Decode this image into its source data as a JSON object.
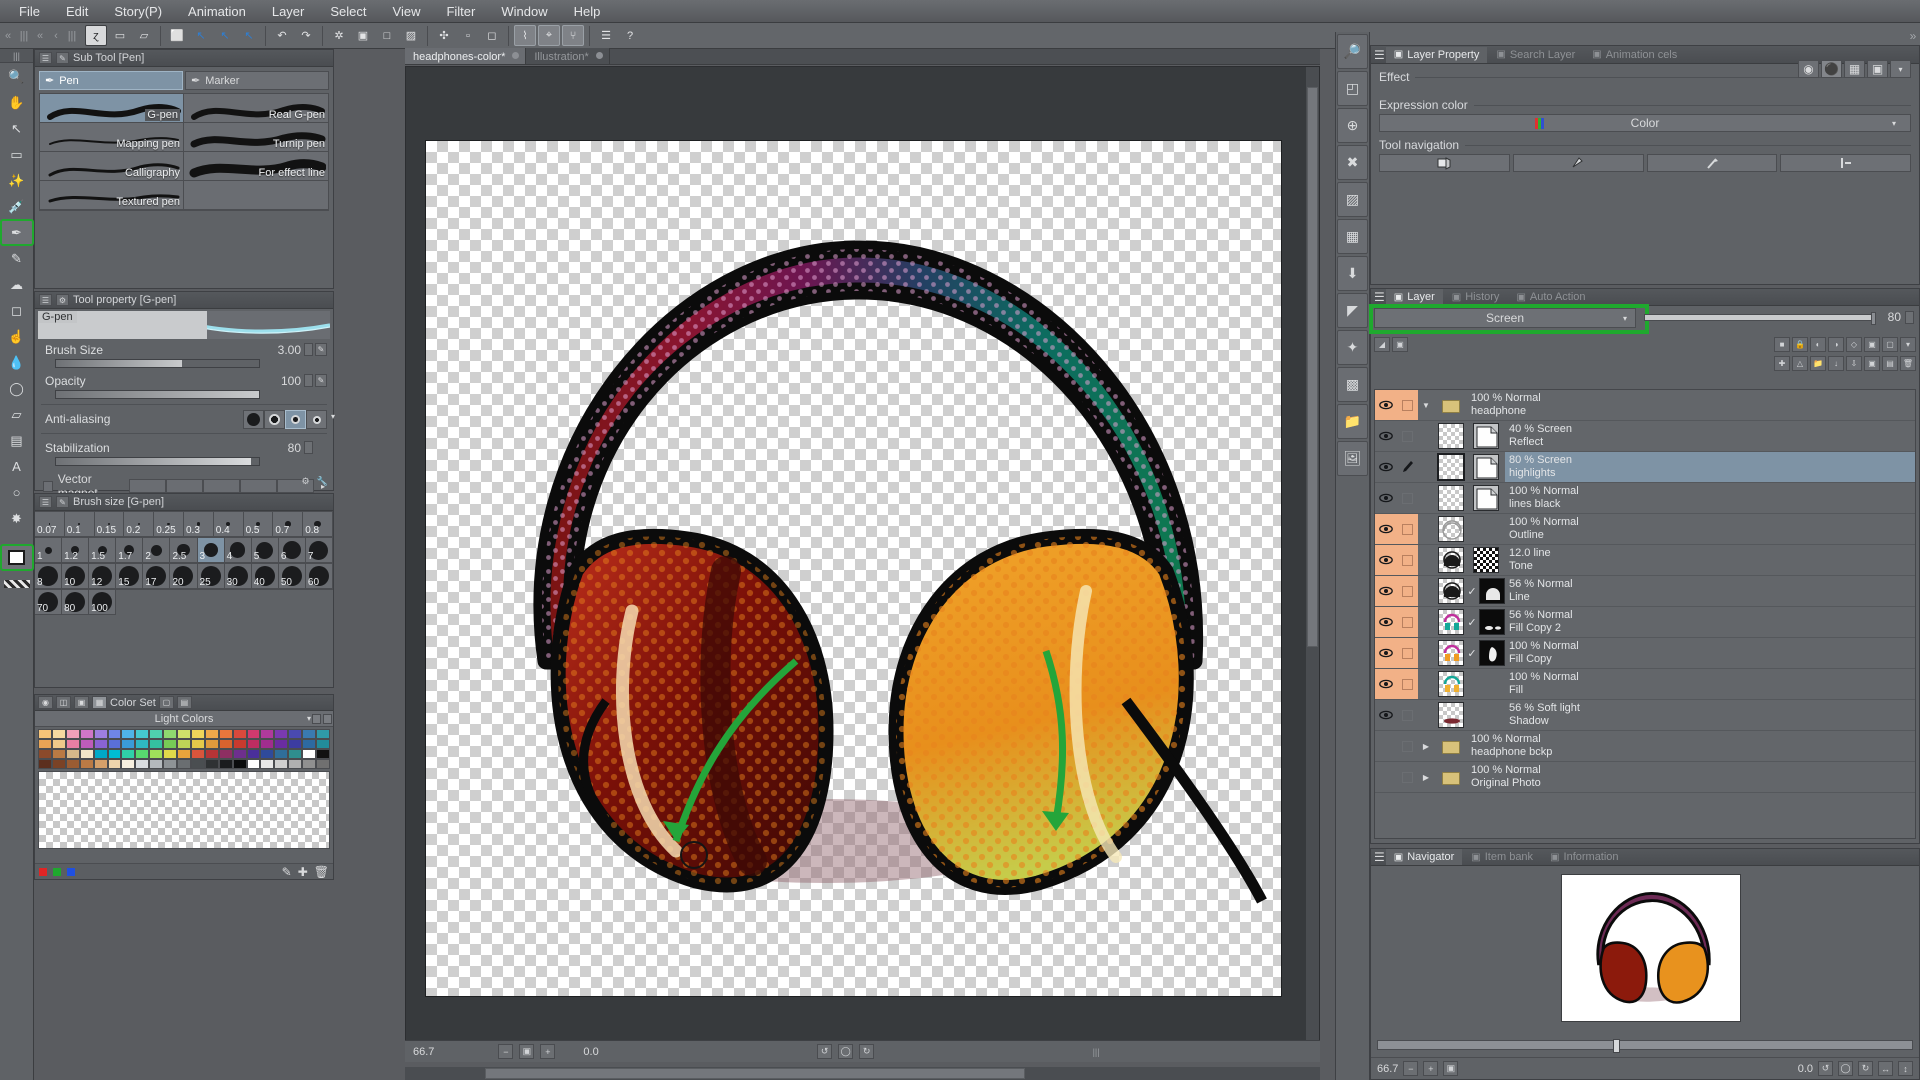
{
  "menubar": {
    "items": [
      "File",
      "Edit",
      "Story(P)",
      "Animation",
      "Layer",
      "Select",
      "View",
      "Filter",
      "Window",
      "Help"
    ]
  },
  "toolbar": {
    "grip": "«",
    "back_arrow": "‹",
    "items": [
      {
        "name": "clip-studio-icon",
        "glyph": "ɀ",
        "state": "on"
      },
      {
        "name": "new-document-icon",
        "glyph": "▭",
        "state": "off"
      },
      {
        "name": "open-file-icon",
        "glyph": "▱",
        "state": "off"
      },
      {
        "name": "save-icon",
        "glyph": "⬜",
        "state": "off"
      },
      {
        "name": "undo-history-icon",
        "glyph": "↖",
        "state": "blue"
      },
      {
        "name": "redo-history-icon",
        "glyph": "↖",
        "state": "blue"
      },
      {
        "name": "cut-icon",
        "glyph": "↖",
        "state": "blue"
      },
      {
        "name": "undo-icon",
        "glyph": "↶",
        "state": "off"
      },
      {
        "name": "redo-icon",
        "glyph": "↷",
        "state": "off"
      },
      {
        "name": "deselect-icon",
        "glyph": "✲",
        "state": "off"
      },
      {
        "name": "fill-selection-icon",
        "glyph": "▣",
        "state": "off"
      },
      {
        "name": "clear-selection-icon",
        "glyph": "□",
        "state": "off"
      },
      {
        "name": "invert-selection-icon",
        "glyph": "▨",
        "state": "off"
      },
      {
        "name": "scale-rotate-icon",
        "glyph": "✣",
        "state": "off"
      },
      {
        "name": "select-all-icon",
        "glyph": "▫",
        "state": "off"
      },
      {
        "name": "erase-icon",
        "glyph": "◻",
        "state": "off"
      },
      {
        "name": "ruler-snap-icon",
        "glyph": "⌇",
        "state": "sel"
      },
      {
        "name": "snap-parallel-icon",
        "glyph": "⌖",
        "state": "sel"
      },
      {
        "name": "snap-perspective-icon",
        "glyph": "⑂",
        "state": "sel"
      },
      {
        "name": "materials-icon",
        "glyph": "☰",
        "state": "off"
      },
      {
        "name": "help-icon",
        "glyph": "?",
        "state": "off"
      }
    ]
  },
  "toolcol": {
    "header": "⋮",
    "tools": [
      {
        "name": "tool-magnifier",
        "label": "Magnifier",
        "active": false
      },
      {
        "name": "tool-move-canvas",
        "label": "Move canvas",
        "active": false
      },
      {
        "name": "tool-operation",
        "label": "Operation",
        "active": false
      },
      {
        "name": "tool-rectangle-select",
        "label": "Rectangle selection",
        "active": false
      },
      {
        "name": "tool-auto-select",
        "label": "Auto select",
        "active": false
      },
      {
        "name": "tool-eyedropper",
        "label": "Eyedropper",
        "active": false
      },
      {
        "name": "tool-pen",
        "label": "Pen",
        "active": true
      },
      {
        "name": "tool-pencil",
        "label": "Pencil",
        "active": false
      },
      {
        "name": "tool-airbrush",
        "label": "Airbrush",
        "active": false
      },
      {
        "name": "tool-eraser",
        "label": "Eraser",
        "active": false
      },
      {
        "name": "tool-blend",
        "label": "Blend",
        "active": false
      },
      {
        "name": "tool-fill",
        "label": "Fill",
        "active": false
      },
      {
        "name": "tool-gradient",
        "label": "Gradient",
        "active": false
      },
      {
        "name": "tool-figure",
        "label": "Figure",
        "active": false
      },
      {
        "name": "tool-frame-border",
        "label": "Frame border",
        "active": false
      },
      {
        "name": "tool-text",
        "label": "Text",
        "active": false
      },
      {
        "name": "tool-balloon",
        "label": "Balloon",
        "active": false
      },
      {
        "name": "tool-decoration",
        "label": "Decoration",
        "active": false
      }
    ],
    "color_swatch": {
      "name": "foreground-background-color",
      "active": true
    }
  },
  "subtool": {
    "tab_title": "Sub Tool [Pen]",
    "tabs": [
      {
        "label": "Pen",
        "selected": true
      },
      {
        "label": "Marker",
        "selected": false
      }
    ],
    "items": [
      {
        "label": "G-pen",
        "selected": true
      },
      {
        "label": "Real G-pen",
        "selected": false
      },
      {
        "label": "Mapping pen",
        "selected": false
      },
      {
        "label": "Turnip pen",
        "selected": false
      },
      {
        "label": "Calligraphy",
        "selected": false
      },
      {
        "label": "For effect line",
        "selected": false
      },
      {
        "label": "Textured pen",
        "selected": false
      }
    ]
  },
  "toolproperty": {
    "tab_title": "Tool property [G-pen]",
    "preview_label": "G-pen",
    "rows": [
      {
        "label": "Brush Size",
        "value": "3.00",
        "fill_pct": 62
      },
      {
        "label": "Opacity",
        "value": "100",
        "fill_pct": 100
      }
    ],
    "antialiasing": {
      "label": "Anti-aliasing",
      "selected_index": 2,
      "count": 4
    },
    "stabilization": {
      "label": "Stabilization",
      "value": "80",
      "fill_pct": 96
    },
    "vector_magnet": {
      "label": "Vector magnet",
      "checked": false
    }
  },
  "brushsize": {
    "tab_title": "Brush size [G-pen]",
    "row1": [
      "0.07",
      "0.1",
      "0.15",
      "0.2",
      "0.25",
      "0.3",
      "0.4",
      "0.5",
      "0.7",
      "0.8"
    ],
    "row2": [
      "1",
      "1.2",
      "1.5",
      "1.7",
      "2",
      "2.5",
      "3",
      "4",
      "5",
      "6",
      "7"
    ],
    "row3": [
      "8",
      "10",
      "12",
      "15",
      "17",
      "20",
      "25",
      "30",
      "40",
      "50",
      "60"
    ],
    "row4": [
      "70",
      "80",
      "100"
    ],
    "selected": "3"
  },
  "colorset": {
    "tab_title": "Color Set",
    "set_name": "Light Colors"
  },
  "documents": {
    "tabs": [
      {
        "label": "headphones-color*",
        "selected": true
      },
      {
        "label": "Illustration*",
        "selected": false
      }
    ]
  },
  "canvas_status": {
    "zoom": "66.7",
    "rotation": "0.0"
  },
  "layerproperty": {
    "tabs": [
      {
        "label": "Layer Property",
        "selected": true,
        "icon": "layer-property-icon"
      },
      {
        "label": "Search Layer",
        "selected": false,
        "icon": "search-layer-icon"
      },
      {
        "label": "Animation cels",
        "selected": false,
        "icon": "animation-cels-icon"
      }
    ],
    "effect_caption": "Effect",
    "expression_caption": "Expression color",
    "expression_value": "Color",
    "toolnav_caption": "Tool navigation"
  },
  "layerpanel": {
    "tabs": [
      {
        "label": "Layer",
        "selected": true,
        "icon": "layer-icon"
      },
      {
        "label": "History",
        "selected": false,
        "icon": "history-icon"
      },
      {
        "label": "Auto Action",
        "selected": false,
        "icon": "auto-action-icon"
      }
    ],
    "blend_mode": "Screen",
    "blend_highlighted": true,
    "opacity": "80",
    "rows": [
      {
        "kind": "folder",
        "blend": "100 % Normal",
        "name": "headphone",
        "visible": true,
        "locked": false,
        "selected": false,
        "pink_eye": true,
        "pink_lock": true,
        "twisty": "▼",
        "indent": 0,
        "mask": null,
        "check": false
      },
      {
        "kind": "layer",
        "blend": "40 % Screen",
        "name": "Reflect",
        "visible": true,
        "locked": false,
        "selected": false,
        "pink_eye": false,
        "pink_lock": false,
        "twisty": "",
        "indent": 1,
        "mask": "paper",
        "check": false
      },
      {
        "kind": "layer",
        "blend": "80 % Screen",
        "name": "highlights",
        "visible": true,
        "locked": false,
        "selected": true,
        "pink_eye": false,
        "pink_lock": false,
        "twisty": "",
        "indent": 1,
        "mask": "paper",
        "check": false
      },
      {
        "kind": "layer",
        "blend": "100 % Normal",
        "name": "lines black",
        "visible": true,
        "locked": false,
        "selected": false,
        "pink_eye": false,
        "pink_lock": false,
        "twisty": "",
        "indent": 1,
        "mask": "paper",
        "check": false
      },
      {
        "kind": "layer",
        "blend": "100 % Normal",
        "name": "Outline",
        "visible": true,
        "locked": false,
        "selected": false,
        "pink_eye": true,
        "pink_lock": true,
        "twisty": "",
        "indent": 1,
        "mask": null,
        "check": false
      },
      {
        "kind": "layer",
        "blend": "12.0 line",
        "name": "Tone",
        "visible": true,
        "locked": false,
        "selected": false,
        "pink_eye": true,
        "pink_lock": true,
        "twisty": "",
        "indent": 1,
        "mask": "halftone",
        "check": false
      },
      {
        "kind": "layer",
        "blend": "56 % Normal",
        "name": "Line",
        "visible": true,
        "locked": false,
        "selected": false,
        "pink_eye": true,
        "pink_lock": true,
        "twisty": "",
        "indent": 1,
        "mask": "dark",
        "check": true
      },
      {
        "kind": "layer",
        "blend": "56 % Normal",
        "name": "Fill Copy 2",
        "visible": true,
        "locked": false,
        "selected": false,
        "pink_eye": true,
        "pink_lock": true,
        "twisty": "",
        "indent": 1,
        "mask": "dark",
        "check": true
      },
      {
        "kind": "layer",
        "blend": "100 % Normal",
        "name": "Fill Copy",
        "visible": true,
        "locked": false,
        "selected": false,
        "pink_eye": true,
        "pink_lock": true,
        "twisty": "",
        "indent": 1,
        "mask": "dark",
        "check": true
      },
      {
        "kind": "layer",
        "blend": "100 % Normal",
        "name": "Fill",
        "visible": true,
        "locked": false,
        "selected": false,
        "pink_eye": true,
        "pink_lock": true,
        "twisty": "",
        "indent": 1,
        "mask": null,
        "check": false
      },
      {
        "kind": "layer",
        "blend": "56 % Soft light",
        "name": "Shadow",
        "visible": true,
        "locked": false,
        "selected": false,
        "pink_eye": false,
        "pink_lock": false,
        "twisty": "",
        "indent": 1,
        "mask": null,
        "check": false
      },
      {
        "kind": "folder",
        "blend": "100 % Normal",
        "name": "headphone bckp",
        "visible": false,
        "locked": false,
        "selected": false,
        "pink_eye": false,
        "pink_lock": false,
        "twisty": "▶",
        "indent": 0,
        "mask": null,
        "check": false
      },
      {
        "kind": "folder",
        "blend": "100 % Normal",
        "name": "Original Photo",
        "visible": false,
        "locked": false,
        "selected": false,
        "pink_eye": false,
        "pink_lock": false,
        "twisty": "▶",
        "indent": 0,
        "mask": null,
        "check": false
      }
    ]
  },
  "navigator": {
    "tabs": [
      {
        "label": "Navigator",
        "selected": true,
        "icon": "navigator-icon"
      },
      {
        "label": "Item bank",
        "selected": false,
        "icon": "item-bank-icon"
      },
      {
        "label": "Information",
        "selected": false,
        "icon": "information-icon"
      }
    ],
    "zoom": "66.7",
    "rotation": "0.0"
  },
  "colors": {
    "accent_green": "#1fa92e",
    "selection_blue": "#7e93a5",
    "panel_bg": "#5f6266",
    "pink_lock": "#f2b187"
  }
}
